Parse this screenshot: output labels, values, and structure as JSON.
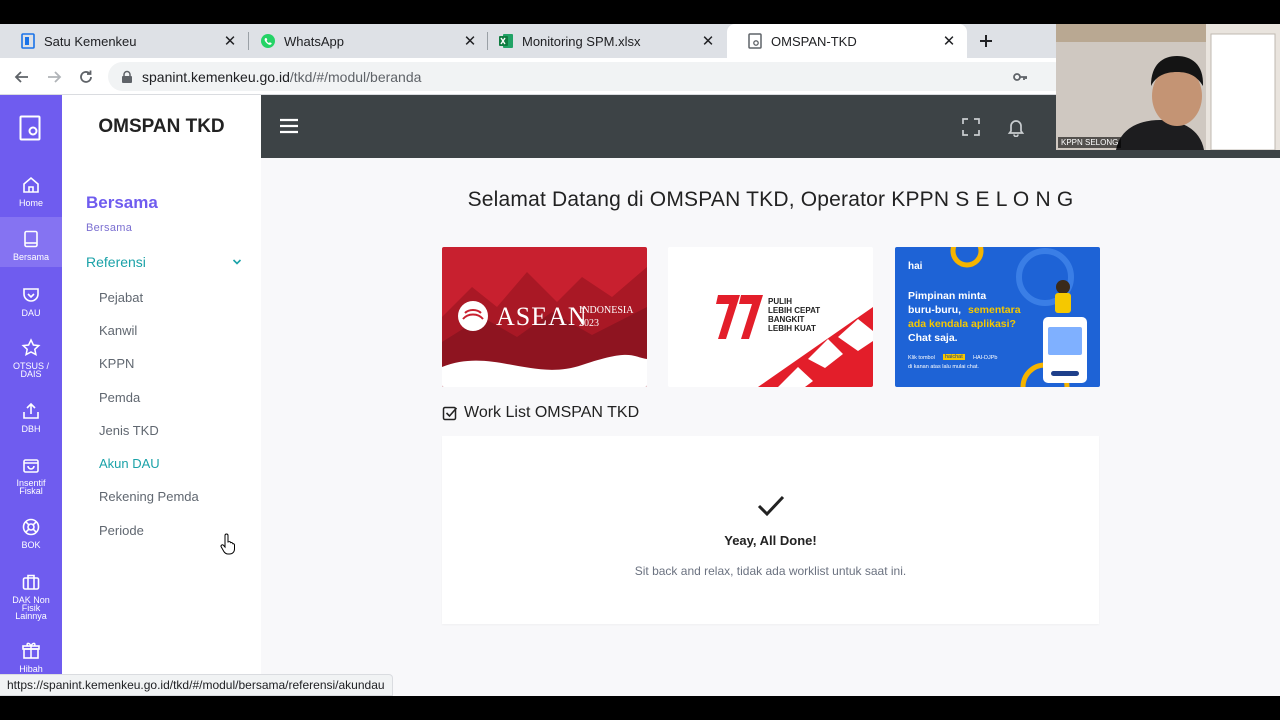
{
  "browser": {
    "tabs": [
      {
        "title": "Satu Kemenkeu",
        "icon": "kemenkeu-icon"
      },
      {
        "title": "WhatsApp",
        "icon": "whatsapp-icon"
      },
      {
        "title": "Monitoring SPM.xlsx",
        "icon": "excel-icon"
      },
      {
        "title": "OMSPAN-TKD",
        "icon": "page-icon"
      }
    ],
    "active_tab": 3,
    "url_host": "spanint.kemenkeu.go.id",
    "url_path": "/tkd/#/modul/beranda",
    "status_url": "https://spanint.kemenkeu.go.id/tkd/#/modul/bersama/referensi/akundau"
  },
  "rail": {
    "items": [
      {
        "label": "Home",
        "icon": "home-icon"
      },
      {
        "label": "Bersama",
        "icon": "book-icon"
      },
      {
        "label": "DAU",
        "icon": "shield-icon"
      },
      {
        "label": "OTSUS / DAIS",
        "icon": "star-icon"
      },
      {
        "label": "DBH",
        "icon": "upload-icon"
      },
      {
        "label": "Insentif Fiskal",
        "icon": "bag-icon"
      },
      {
        "label": "BOK",
        "icon": "lifebuoy-icon"
      },
      {
        "label": "DAK Non Fisik Lainnya",
        "icon": "briefcase-icon"
      },
      {
        "label": "Hibah",
        "icon": "gift-icon"
      }
    ]
  },
  "sidebar": {
    "brand": "OMSPAN TKD",
    "section_title": "Bersama",
    "section_sub": "Bersama",
    "group_label": "Referensi",
    "links": [
      "Pejabat",
      "Kanwil",
      "KPPN",
      "Pemda",
      "Jenis TKD",
      "Akun DAU",
      "Rekening Pemda",
      "Periode"
    ],
    "active_link": 5
  },
  "main": {
    "welcome": "Selamat Datang di OMSPAN TKD, Operator KPPN S E L O N G",
    "banners": {
      "asean_main": "ASEAN",
      "asean_sub": "INDONESIA",
      "asean_year": "2023",
      "hut_line1": "PULIH",
      "hut_line2": "LEBIH CEPAT",
      "hut_line3": "BANGKIT",
      "hut_line4": "LEBIH KUAT",
      "hai_brand": "hai",
      "hai_text1": "Pimpinan minta",
      "hai_text2": "buru-buru,",
      "hai_text3": "sementara",
      "hai_text4": "ada kendala aplikasi?",
      "hai_text5": "Chat saja.",
      "hai_small1": "Klik tombol",
      "hai_small_tag": "haichat",
      "hai_small2": "HAI-DJPb",
      "hai_small3": "di kanan atas lalu mulai chat."
    },
    "worklist_title": "Work List OMSPAN TKD",
    "done_title": "Yeay, All Done!",
    "done_sub": "Sit back and relax, tidak ada worklist untuk saat ini."
  },
  "webcam": {
    "label": "KPPN SELONG"
  },
  "colors": {
    "rail": "#6f5cef",
    "accent_teal": "#1aa2a8",
    "topbar": "#3d4346",
    "asean_red": "#c8202f"
  }
}
